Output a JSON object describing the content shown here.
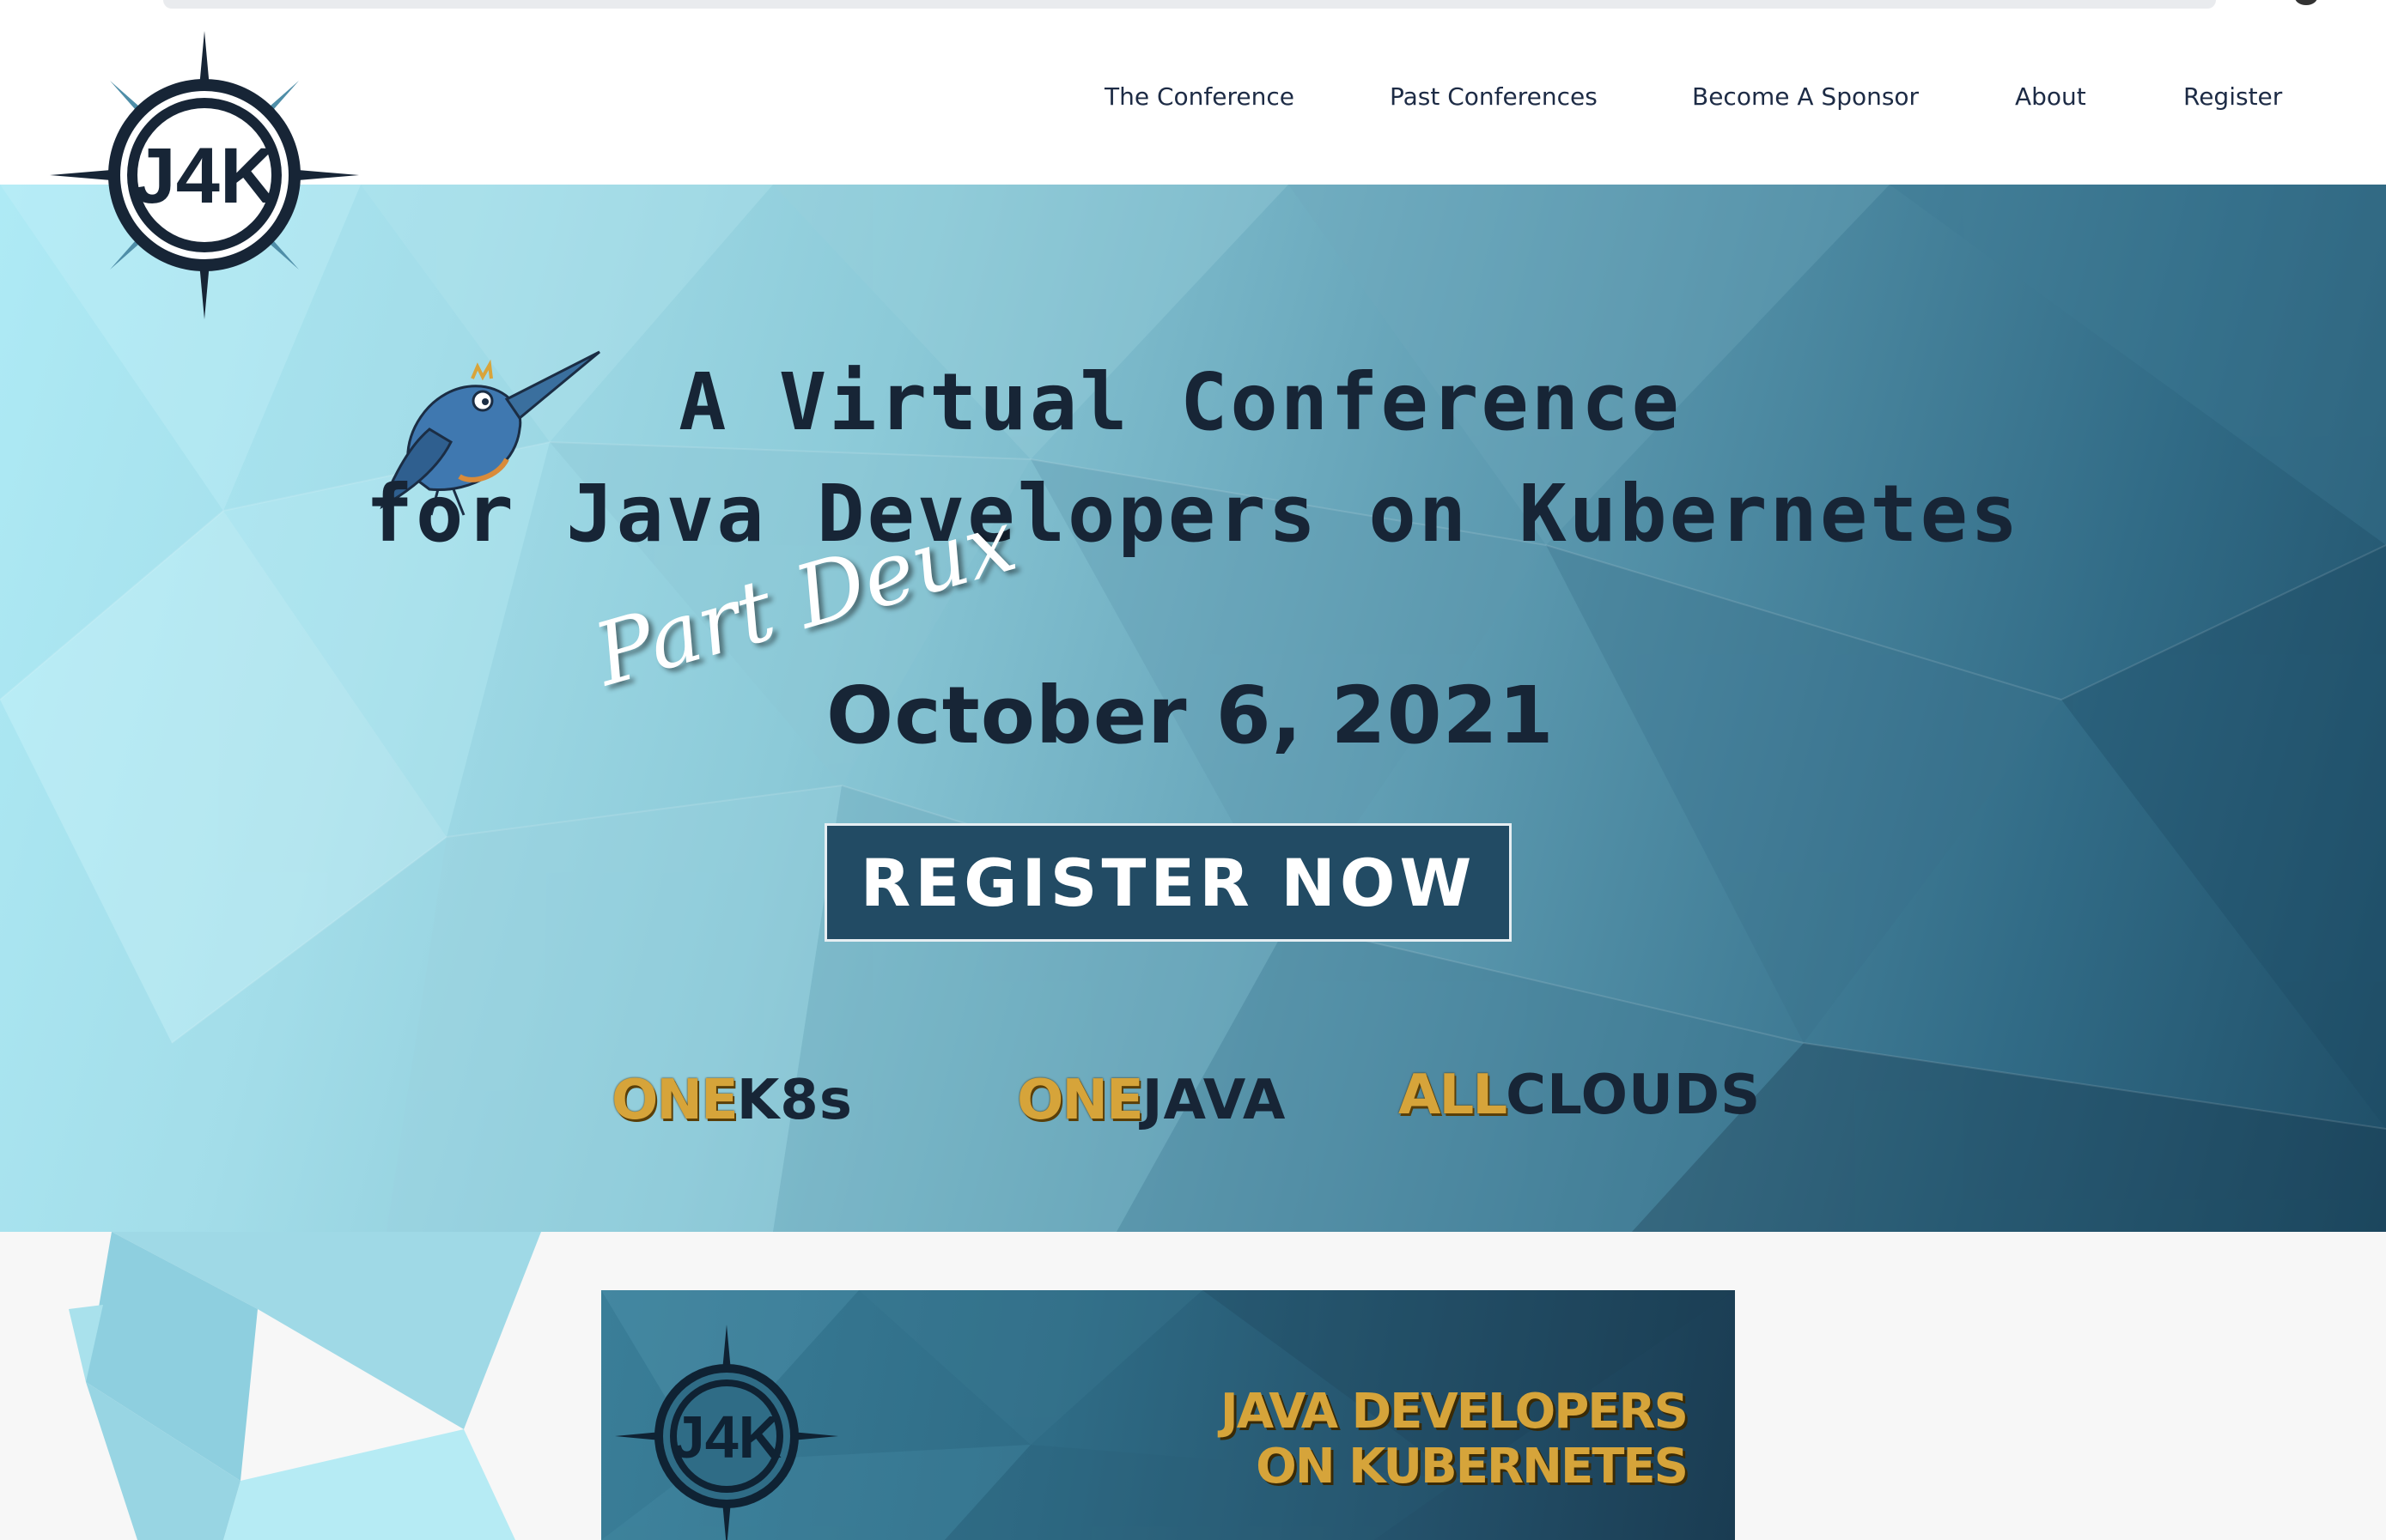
{
  "nav": {
    "items": [
      {
        "label": "The Conference"
      },
      {
        "label": "Past Conferences"
      },
      {
        "label": "Become A Sponsor"
      },
      {
        "label": "About"
      },
      {
        "label": "Register"
      }
    ]
  },
  "logo": {
    "text": "J4K"
  },
  "hero": {
    "line1": "A Virtual Conference",
    "line2": "for Java Developers on Kubernetes",
    "subtitle_script": "Part Deux",
    "date": "October 6, 2021",
    "cta_label": "REGISTER NOW",
    "taglines": [
      {
        "accent": "ONE",
        "word": "K8s"
      },
      {
        "accent": "ONE",
        "word": "JAVA"
      },
      {
        "accent": "ALL",
        "word": "CLOUDS"
      }
    ]
  },
  "banner": {
    "line1": "JAVA DEVELOPERS",
    "line2": "ON KUBERNETES",
    "logo_text": "J4K"
  },
  "colors": {
    "navy": "#172536",
    "nav_text": "#1d2b45",
    "gold": "#d6a43a",
    "cta_bg": "#224b64",
    "light_blue": "#aeeaf5"
  }
}
